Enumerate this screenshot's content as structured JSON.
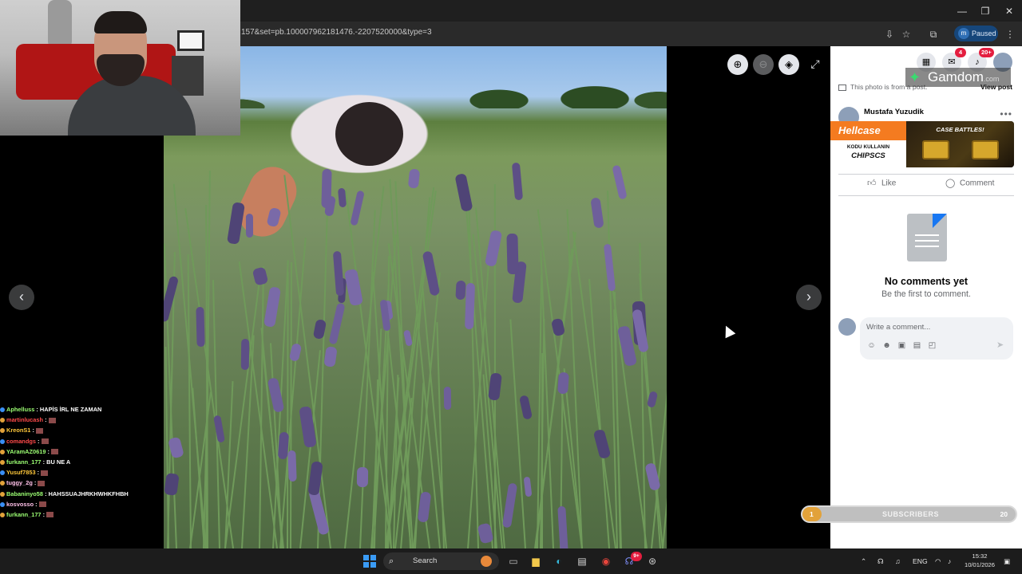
{
  "browser": {
    "url": "157&set=pb.100007962181476.-2207520000&type=3",
    "profile_initial": "m",
    "profile_status": "Paused"
  },
  "viewer": {
    "tools": [
      "zoom-in",
      "zoom-out",
      "tag",
      "fullscreen"
    ],
    "prev_glyph": "‹",
    "next_glyph": "›"
  },
  "chat": {
    "lines": [
      {
        "user": "Aphelluss",
        "msg": ": HAPİS İRL NE ZAMAN",
        "color": "#9cff73"
      },
      {
        "user": "martinlucash",
        "msg": ":",
        "color": "#ff4a4a",
        "emote": true
      },
      {
        "user": "KreonS1",
        "msg": ":",
        "color": "#ffc83a",
        "emote": true
      },
      {
        "user": "comandgs",
        "msg": ":",
        "color": "#ff4a4a",
        "emote": true
      },
      {
        "user": "YAramAZ0619",
        "msg": ":",
        "color": "#9cff73",
        "emote": true
      },
      {
        "user": "furkann_177",
        "msg": ": BU NE A",
        "color": "#9cff73"
      },
      {
        "user": "Yusuf7853",
        "msg": ":",
        "color": "#ffc83a",
        "emote": true
      },
      {
        "user": "tuggy_2g",
        "msg": ":",
        "color": "#ffc0e8",
        "emote": true
      },
      {
        "user": "Babaninyo58",
        "msg": ": HAHSSUAJHRKHWHKFHBH",
        "color": "#9cff73"
      },
      {
        "user": "kosvosso",
        "msg": ":",
        "color": "#ffc0e8",
        "emote": true
      },
      {
        "user": "furkann_177",
        "msg": ":",
        "color": "#9cff73",
        "emote": true
      }
    ]
  },
  "sidebar": {
    "messenger_badge": "4",
    "notifications_badge": "20+",
    "gamdom_brand": "Gamdom",
    "gamdom_suffix": ".com",
    "from_post_text": "This photo is from a post.",
    "view_post_label": "View post",
    "author_name": "Mustafa Yuzudik",
    "ad": {
      "brand": "Hellcase",
      "kodu_text": "KODU KULLANIN",
      "code": "CHIPSCS",
      "banner": "CASE BATTLES!"
    },
    "like_label": "Like",
    "comment_label": "Comment",
    "no_comments_title": "No comments yet",
    "no_comments_sub": "Be the first to comment.",
    "comment_placeholder": "Write a comment..."
  },
  "subscribers": {
    "label": "SUBSCRIBERS",
    "current": "1",
    "goal": "20",
    "progress": 0.05
  },
  "taskbar": {
    "search_label": "Search",
    "language": "ENG",
    "time": "15:32",
    "date": "10/01/2026",
    "discord_badge": "9+"
  },
  "colors": {
    "facebook_blue": "#1877f2",
    "hellcase_orange": "#f47b20",
    "notif_red": "#e41e3f",
    "subs_fill": "#e2a23a"
  }
}
